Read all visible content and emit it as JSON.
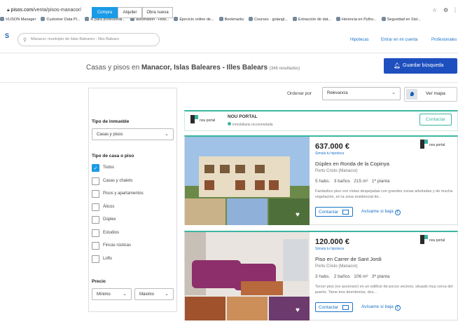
{
  "browser": {
    "url_host": "pisos.com",
    "url_path": "/venta/pisos-manacor/",
    "bookmarks": [
      "VLISON Manager",
      "Customer Data Pl...",
      "R para profesional...",
      "automation - How...",
      "Ejercicio online de...",
      "Bookmarks",
      "Courses · golangl...",
      "Extracción de dat...",
      "Herencia en Pytho...",
      "Seguridad en Sist..."
    ]
  },
  "header": {
    "logo": "S",
    "search_placeholder": "Manacor, municipio de Islas Baleares - Illes Balears",
    "links": [
      "Hipotecas",
      "Entrar en mi cuenta",
      "Profesionales"
    ]
  },
  "page": {
    "title_prefix": "Casas y pisos en ",
    "title_place": "Manacor, Islas Baleares - Illes Balears",
    "results": "(346 resultados)",
    "save_search": "Guardar búsqueda"
  },
  "filters": {
    "tabs": [
      "Compra",
      "Alquiler",
      "Obra nueva"
    ],
    "property_type_label": "Tipo de inmueble",
    "property_type_value": "Casas y pisos",
    "house_type_label": "Tipo de casa o piso",
    "house_types": [
      {
        "label": "Todos",
        "checked": true
      },
      {
        "label": "Casas y chalets",
        "checked": false
      },
      {
        "label": "Pisos y apartamentos",
        "checked": false
      },
      {
        "label": "Áticos",
        "checked": false
      },
      {
        "label": "Dúplex",
        "checked": false
      },
      {
        "label": "Estudios",
        "checked": false
      },
      {
        "label": "Fincas rústicas",
        "checked": false
      },
      {
        "label": "Lofts",
        "checked": false
      }
    ],
    "price_label": "Precio",
    "price_min": "Mínimo",
    "price_max": "Máximo"
  },
  "sort": {
    "label": "Ordenar por",
    "value": "Relevancia",
    "map_label": "Ver mapa"
  },
  "agency": {
    "logo_text": "nou portal",
    "name": "NOU PORTAL",
    "subtitle": "Inmobiliaria recomendada",
    "contact": "Contactar"
  },
  "listings": [
    {
      "price": "637.000 €",
      "simula": "Simula tu hipoteca",
      "title": "Dúplex en Ronda de la Copinya",
      "location": "Porto Cristo (Manacor)",
      "features": "5 habs.   3 baños   215 m²   1ª planta",
      "description": "Fantástico piso con vistas despejadas con grandes zonas arboladas y de mucha vegetación, en la zona residencial de...",
      "contact": "Contactar",
      "alert": "Avísame si baja",
      "alert_icon": "€"
    },
    {
      "price": "120.000 €",
      "simula": "Simula tu hipoteca",
      "title": "Piso en Carrer de Sant Jordi",
      "location": "Porto Cristo (Manacor)",
      "features": "3 habs.   2 baños   106 m²   3ª planta",
      "description": "Tercer piso (no ascensor) en un edificio de pocos vecinos, situado muy cerca del puerto. Tiene tres dormitorios, dos...",
      "contact": "Contactar",
      "alert": "Avísame si baja",
      "alert_icon": "€"
    }
  ],
  "colors": {
    "accent": "#1e4fbf",
    "link": "#1a73c7",
    "teal": "#3ab5a0",
    "tab_active": "#1a9be6"
  }
}
